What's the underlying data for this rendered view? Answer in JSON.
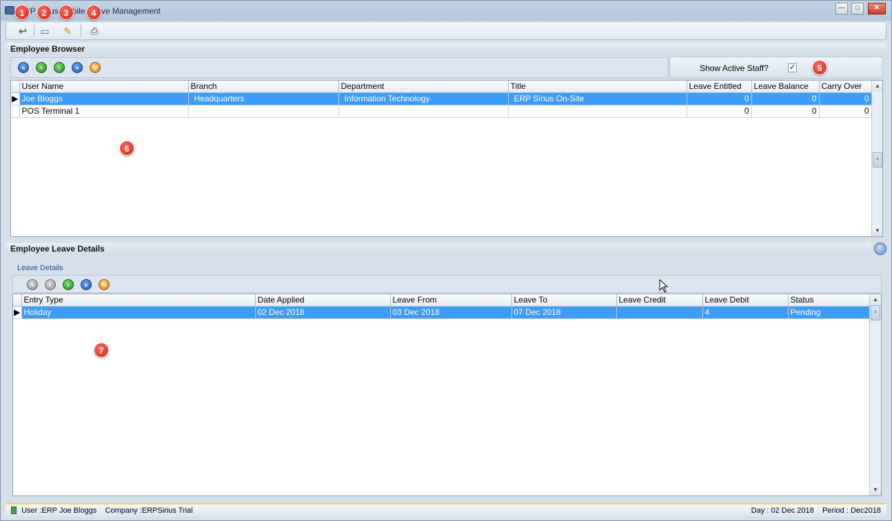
{
  "window": {
    "title": "ERP Sirius Mobile Leave Management",
    "minimize": "—",
    "maximize": "□",
    "close": "✕"
  },
  "toolbar": {
    "icons": [
      "back-icon",
      "new-icon",
      "edit-icon",
      "print-icon"
    ]
  },
  "employee_browser": {
    "header": "Employee Browser",
    "show_active_label": "Show Active Staff?",
    "show_active_checked": true,
    "checkmark": "✓",
    "columns": [
      "User Name",
      "Branch",
      "Department",
      "Title",
      "Leave Entitled",
      "Leave Balance",
      "Carry Over"
    ],
    "rows": [
      {
        "user": "Joe Bloggs",
        "branch": "Headquarters",
        "department": "Information Technology",
        "title": "ERP Sirius On-Site",
        "entitled": "0",
        "balance": "0",
        "carry": "0",
        "selected": true
      },
      {
        "user": "POS Terminal 1",
        "branch": "",
        "department": "",
        "title": "",
        "entitled": "0",
        "balance": "0",
        "carry": "0",
        "selected": false
      }
    ]
  },
  "leave_details": {
    "header": "Employee  Leave Details",
    "tab_label": "Leave Details",
    "columns": [
      "Entry Type",
      "Date Applied",
      "Leave From",
      "Leave To",
      "Leave Credit",
      "Leave Debit",
      "Status"
    ],
    "rows": [
      {
        "entry_type": "Holiday",
        "date_applied": "02 Dec 2018",
        "leave_from": "03 Dec 2018",
        "leave_to": "07 Dec 2018",
        "credit": "",
        "debit": "4",
        "status": "Pending",
        "selected": true
      }
    ]
  },
  "badges": [
    "1",
    "2",
    "3",
    "4",
    "5",
    "6",
    "7"
  ],
  "status_bar": {
    "user": "User :ERP Joe Bloggs",
    "company": "Company :ERPSirius Trial",
    "day": "Day : 02 Dec 2018",
    "period": "Period : Dec2018"
  },
  "colors": {
    "selection": "#3d9cf5",
    "badge": "#d21f14",
    "statusbar_accent": "#f0d640"
  }
}
